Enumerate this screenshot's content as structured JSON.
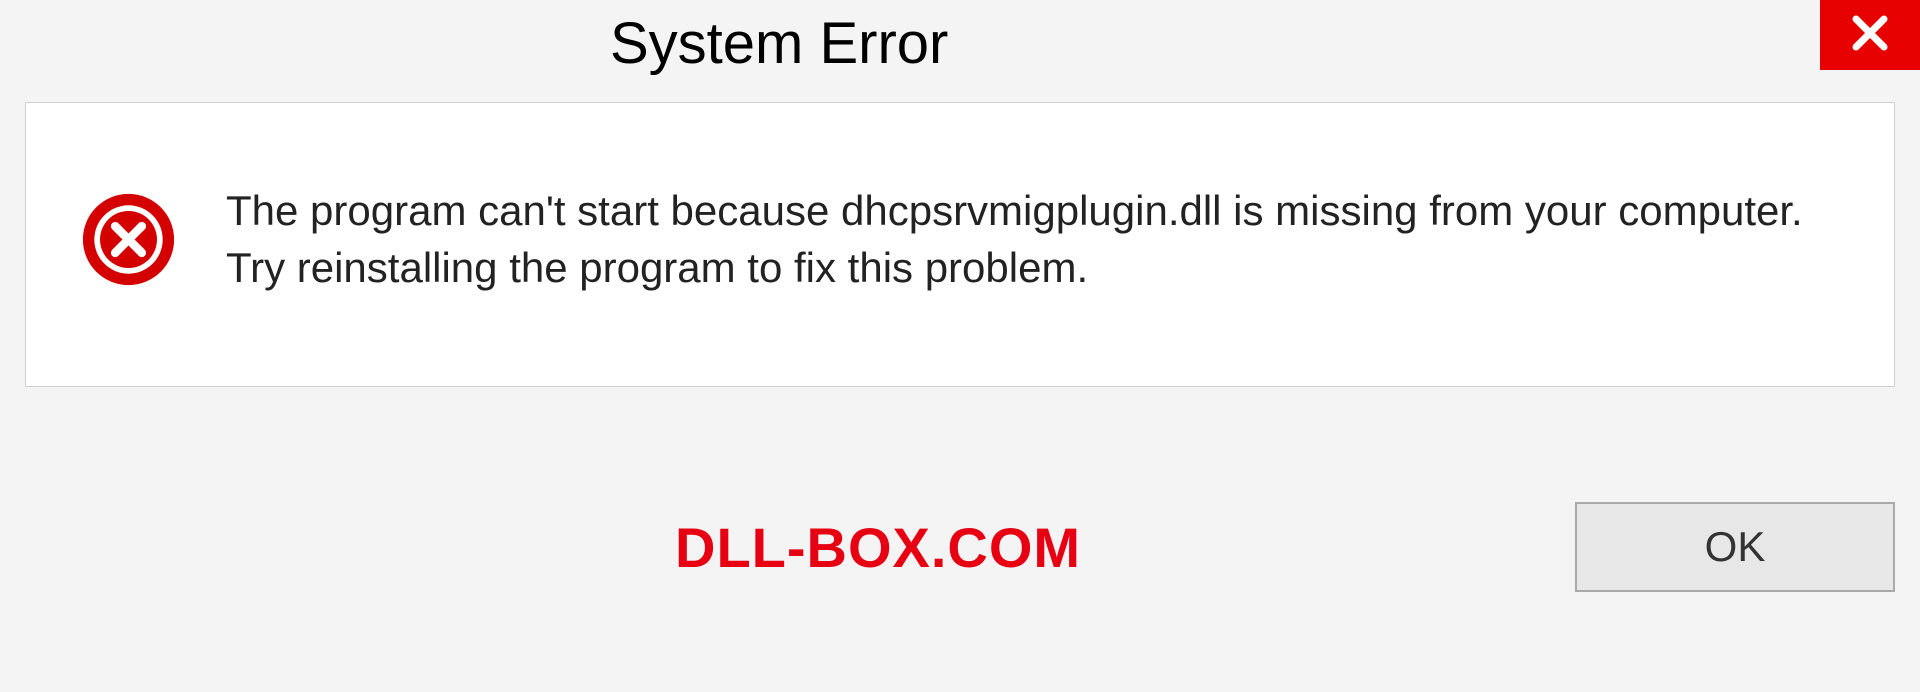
{
  "dialog": {
    "title": "System Error",
    "message": "The program can't start because dhcpsrvmigplugin.dll is missing from your computer. Try reinstalling the program to fix this problem.",
    "ok_label": "OK"
  },
  "watermark": "DLL-BOX.COM",
  "colors": {
    "error_red": "#e60000",
    "watermark_red": "#e60012",
    "panel_bg": "#ffffff",
    "dialog_bg": "#f4f4f4"
  }
}
